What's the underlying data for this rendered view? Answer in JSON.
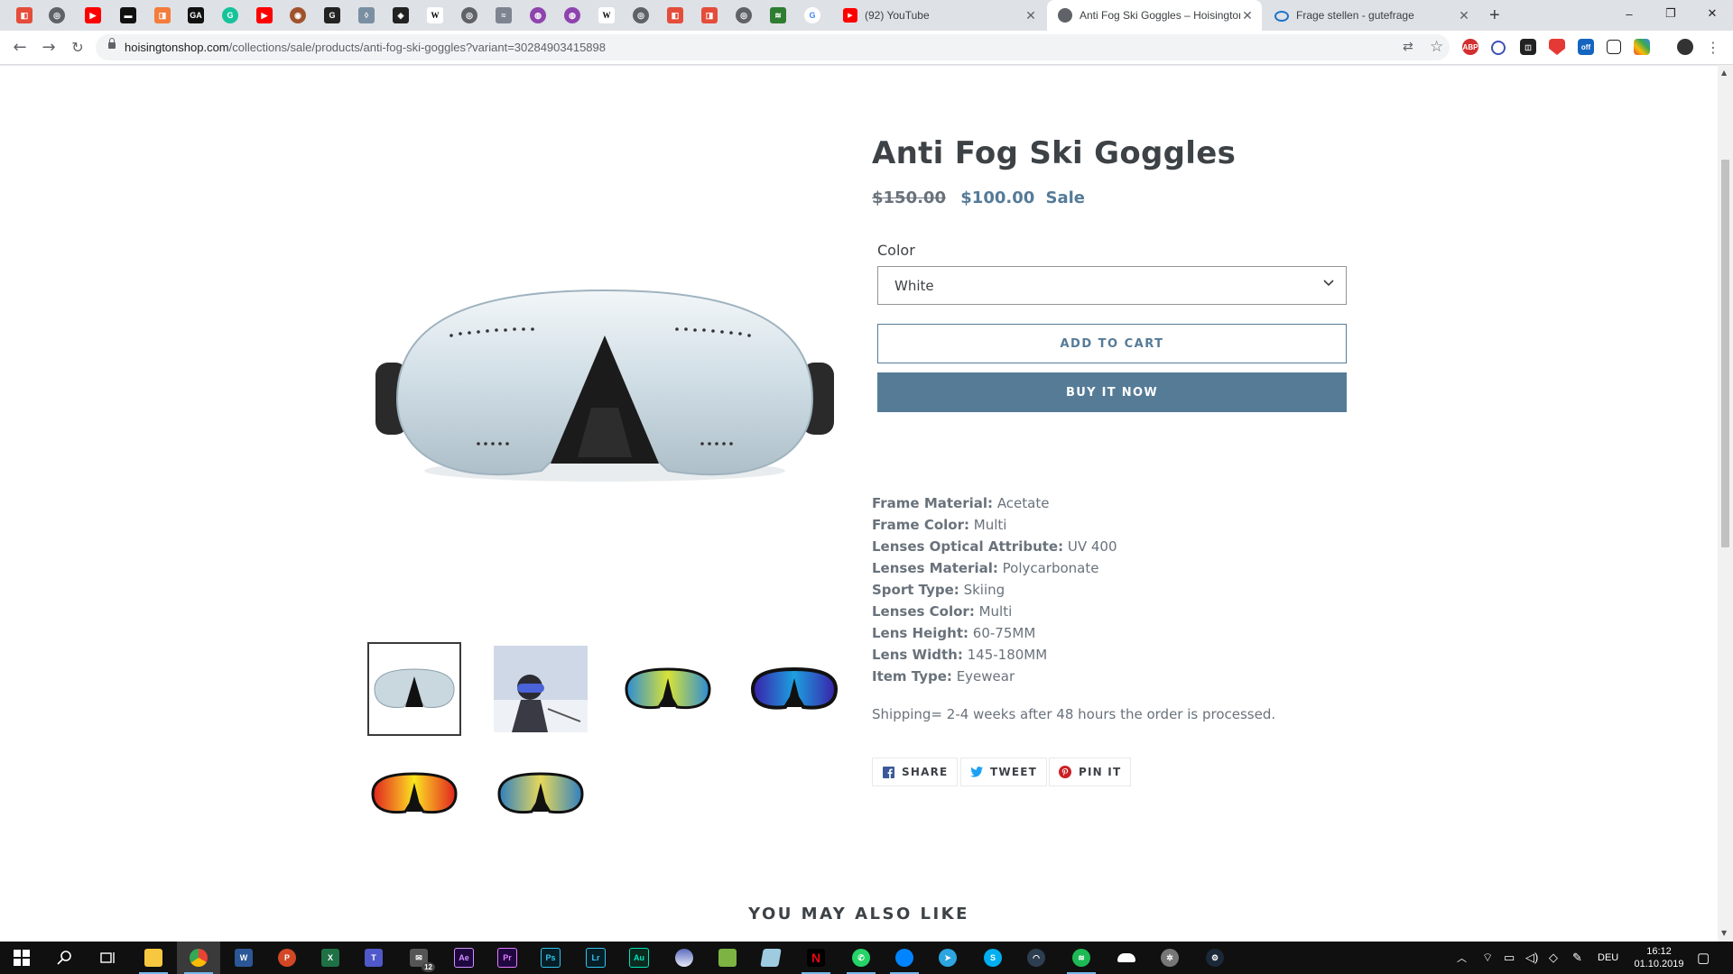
{
  "browser": {
    "tabs": [
      {
        "title": "(92) YouTube",
        "icon": "youtube-icon",
        "active": false
      },
      {
        "title": "Anti Fog Ski Goggles – Hoisington",
        "icon": "globe-icon",
        "active": true
      },
      {
        "title": "Frage stellen - gutefrage",
        "icon": "gutefrage-icon",
        "active": false
      }
    ],
    "new_tab": "+",
    "url_domain": "hoisingtonshop.com",
    "url_path": "/collections/sale/products/anti-fog-ski-goggles?variant=30284903415898",
    "window_controls": [
      "–",
      "❐",
      "✕"
    ]
  },
  "product": {
    "title": "Anti Fog Ski Goggles",
    "old_price": "$150.00",
    "new_price": "$100.00",
    "sale_label": "Sale",
    "color_label": "Color",
    "color_value": "White",
    "add_to_cart": "ADD TO CART",
    "buy_now": "BUY IT NOW",
    "specs": [
      {
        "key": "Frame Material:",
        "value": "Acetate"
      },
      {
        "key": "Frame Color:",
        "value": "Multi"
      },
      {
        "key": "Lenses Optical Attribute:",
        "value": "UV 400"
      },
      {
        "key": "Lenses Material:",
        "value": "Polycarbonate"
      },
      {
        "key": "Sport Type:",
        "value": "Skiing"
      },
      {
        "key": "Lenses Color:",
        "value": "Multi"
      },
      {
        "key": "Lens Height:",
        "value": "60-75MM"
      },
      {
        "key": "Lens Width:",
        "value": "145-180MM"
      },
      {
        "key": "Item Type:",
        "value": "Eyewear"
      }
    ],
    "shipping": "Shipping= 2-4 weeks after 48 hours the order is processed.",
    "share": {
      "share": "SHARE",
      "tweet": "TWEET",
      "pin": "PIN IT"
    },
    "thumbnails": [
      "white-goggles",
      "skier-photo",
      "rainbow-goggles",
      "blue-goggles",
      "red-goggles",
      "gold-goggles"
    ]
  },
  "related_title": "YOU MAY ALSO LIKE",
  "taskbar": {
    "mail_badge": "12",
    "language": "DEU",
    "time": "16:12",
    "date": "01.10.2019"
  },
  "colors": {
    "accent": "#557b97",
    "text": "#3d4246",
    "muted": "#69727b"
  }
}
